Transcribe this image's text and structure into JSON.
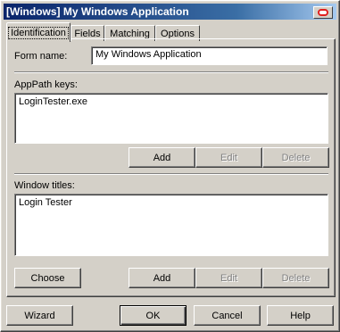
{
  "window": {
    "title": "[Windows] My Windows Application"
  },
  "tabs": [
    {
      "label": "Identification",
      "active": true
    },
    {
      "label": "Fields",
      "active": false
    },
    {
      "label": "Matching",
      "active": false
    },
    {
      "label": "Options",
      "active": false
    }
  ],
  "form": {
    "name_label": "Form name:",
    "name_value": "My Windows Application"
  },
  "apppath": {
    "label": "AppPath keys:",
    "items": [
      "LoginTester.exe"
    ],
    "add_label": "Add",
    "edit_label": "Edit",
    "delete_label": "Delete"
  },
  "window_titles": {
    "label": "Window titles:",
    "items": [
      "Login Tester"
    ],
    "choose_label": "Choose",
    "add_label": "Add",
    "edit_label": "Edit",
    "delete_label": "Delete"
  },
  "footer": {
    "wizard_label": "Wizard",
    "ok_label": "OK",
    "cancel_label": "Cancel",
    "help_label": "Help"
  },
  "colors": {
    "face": "#d4d0c8",
    "title_start": "#0a246a",
    "title_end": "#a6caf0",
    "close_ring": "#e02020"
  },
  "icons": {
    "close": "close-icon"
  }
}
